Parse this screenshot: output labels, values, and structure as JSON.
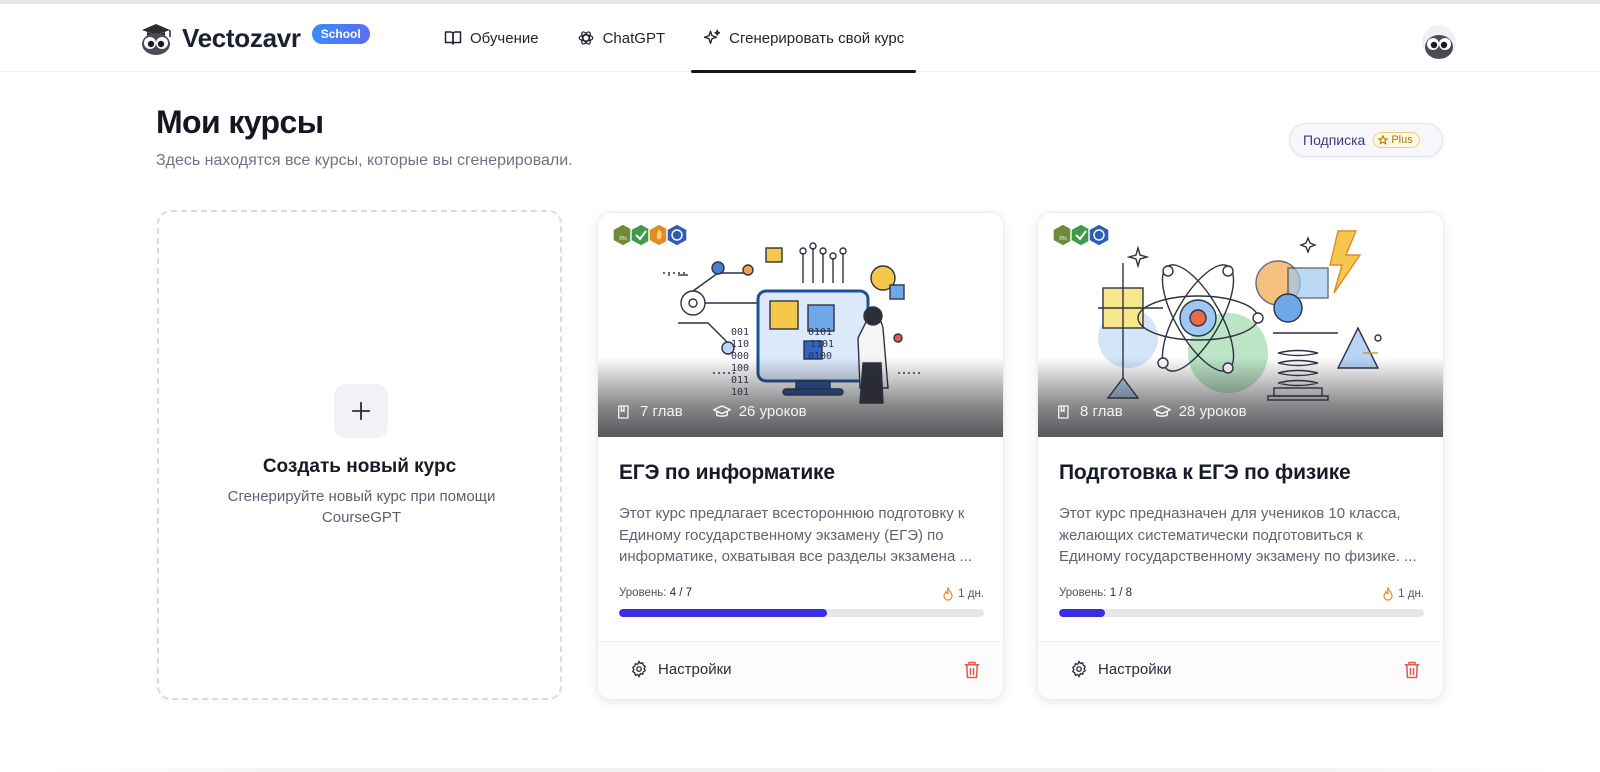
{
  "header": {
    "logo_text": "Vectozavr",
    "logo_badge": "School",
    "nav": [
      {
        "label": "Обучение",
        "icon": "book-icon"
      },
      {
        "label": "ChatGPT",
        "icon": "openai-icon"
      },
      {
        "label": "Сгенерировать свой курс",
        "icon": "sparkles-icon",
        "active": true
      }
    ]
  },
  "page": {
    "title": "Мои курсы",
    "subtitle": "Здесь находятся все курсы, которые вы сгенерировали.",
    "subscription_label": "Подписка",
    "plan_label": "Plus"
  },
  "new_course": {
    "title": "Создать новый курс",
    "description": "Сгенерируйте новый курс при помощи CourseGPT"
  },
  "courses": [
    {
      "chapters": "7 глав",
      "lessons": "26 уроков",
      "title": "ЕГЭ по информатике",
      "description": "Этот курс предлагает всестороннюю подготовку к Единому государственному экзамену (ЕГЭ) по информатике, охватывая все разделы экзамена ...",
      "level_label": "Уровень:",
      "level_value": "4 / 7",
      "level_progress": 0.57,
      "streak": "1 дн.",
      "settings_label": "Настройки"
    },
    {
      "chapters": "8 глав",
      "lessons": "28 уроков",
      "title": "Подготовка к ЕГЭ по физике",
      "description": "Этот курс предназначен для учеников 10 класса, желающих систематически подготовиться к Единому государственному экзамену по физике. ...",
      "level_label": "Уровень:",
      "level_value": "1 / 8",
      "level_progress": 0.125,
      "streak": "1 дн.",
      "settings_label": "Настройки"
    }
  ],
  "colors": {
    "accent": "#3b2ee0",
    "badge": "#4a7cf7",
    "delete": "#e0584f",
    "streak": "#f08a24"
  }
}
